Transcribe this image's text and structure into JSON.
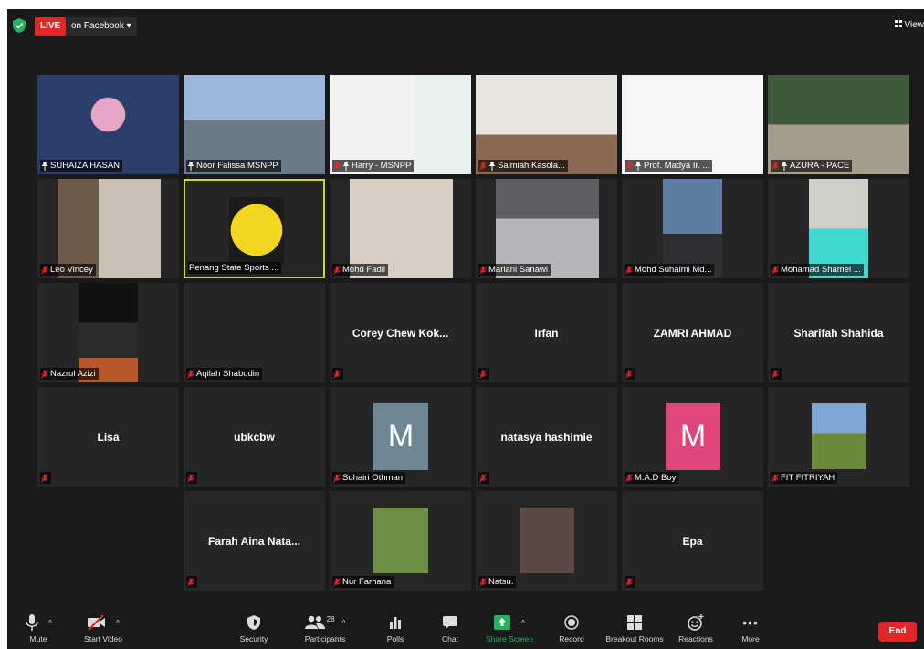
{
  "topbar": {
    "live_label": "LIVE",
    "stream_target": "on Facebook ▾",
    "view_label": "View"
  },
  "tiles": [
    {
      "name": "SUHAIZA HASAN",
      "muted": false,
      "pinned": true
    },
    {
      "name": "Noor Falissa MSNPP",
      "muted": false,
      "pinned": true
    },
    {
      "name": "Harry - MSNPP",
      "muted": true,
      "pinned": true
    },
    {
      "name": "Salmiah Kasola...",
      "muted": true,
      "pinned": true
    },
    {
      "name": "Prof. Madya Ir. ...",
      "muted": true,
      "pinned": true
    },
    {
      "name": "AZURA - PACE",
      "muted": true,
      "pinned": true
    },
    {
      "name": "Leo Vincey",
      "muted": true
    },
    {
      "name": "Penang State Sports ...",
      "muted": false
    },
    {
      "name": "Mohd Fadil",
      "muted": true
    },
    {
      "name": "Mariani Sanawi",
      "muted": true
    },
    {
      "name": "Mohd Suhaimi Md...",
      "muted": true
    },
    {
      "name": "Mohamad Shamel ...",
      "muted": true
    },
    {
      "name": "Nazrul Azizi",
      "muted": true
    },
    {
      "name": "Aqilah Shabudin",
      "muted": true
    },
    {
      "name": "Corey Chew Kok...",
      "display": "Corey Chew Kok...",
      "muted": true
    },
    {
      "name": "Irfan",
      "display": "Irfan",
      "muted": true
    },
    {
      "name": "ZAMRI AHMAD",
      "display": "ZAMRI AHMAD",
      "muted": true
    },
    {
      "name": "Sharifah Shahida",
      "display": "Sharifah Shahida",
      "muted": true
    },
    {
      "name": "Lisa",
      "display": "Lisa",
      "muted": true
    },
    {
      "name": "ubkcbw",
      "display": "ubkcbw",
      "muted": true
    },
    {
      "name": "Suhairi Othman",
      "avatar_letter": "M",
      "avatar_color": "#6f8795",
      "muted": true
    },
    {
      "name": "natasya hashimie",
      "display": "natasya hashimie",
      "muted": true
    },
    {
      "name": "M.A.D Boy",
      "avatar_letter": "M",
      "avatar_color": "#e0457b",
      "muted": true
    },
    {
      "name": "FIT FITRIYAH",
      "muted": true
    },
    {
      "name": "Farah Aina Nata...",
      "display": "Farah Aina Nata...",
      "muted": true
    },
    {
      "name": "Nur Farhana",
      "muted": true
    },
    {
      "name": "Natsu.",
      "muted": true
    },
    {
      "name": "Epa",
      "display": "Epa",
      "muted": true
    }
  ],
  "toolbar": {
    "mute": "Mute",
    "start_video": "Start Video",
    "security": "Security",
    "participants": "Participants",
    "participants_count": "28",
    "polls": "Polls",
    "chat": "Chat",
    "share_screen": "Share Screen",
    "record": "Record",
    "breakout_rooms": "Breakout Rooms",
    "reactions": "Reactions",
    "more": "More",
    "end": "End"
  },
  "colors": {
    "background": "#1a1a1a",
    "tile": "#262626",
    "active_border": "#c7d73c",
    "live_red": "#e02828",
    "share_green": "#23b35f",
    "muted_red": "#e02828"
  }
}
